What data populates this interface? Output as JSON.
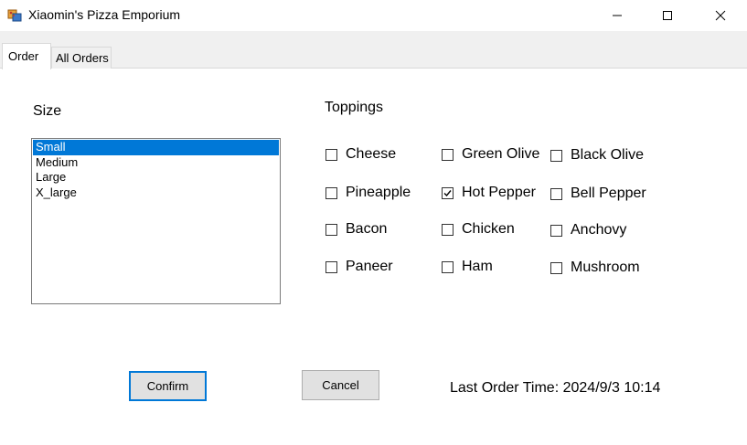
{
  "window": {
    "title": "Xiaomin's Pizza Emporium",
    "icon": "pizza-app-icon",
    "controls": [
      "minimize-icon",
      "maximize-icon",
      "close-icon"
    ]
  },
  "tabs": [
    {
      "label": "Order",
      "selected": true
    },
    {
      "label": "All Orders",
      "selected": false
    }
  ],
  "size": {
    "label": "Size",
    "options": [
      "Small",
      "Medium",
      "Large",
      "X_large"
    ],
    "selected": "Small"
  },
  "toppings": {
    "label": "Toppings",
    "items": [
      {
        "label": "Cheese",
        "checked": false
      },
      {
        "label": "Green Olive",
        "checked": false
      },
      {
        "label": "Black Olive",
        "checked": false
      },
      {
        "label": "Pineapple",
        "checked": false
      },
      {
        "label": "Hot Pepper",
        "checked": true
      },
      {
        "label": "Bell Pepper",
        "checked": false
      },
      {
        "label": "Bacon",
        "checked": false
      },
      {
        "label": "Chicken",
        "checked": false
      },
      {
        "label": "Anchovy",
        "checked": false
      },
      {
        "label": "Paneer",
        "checked": false
      },
      {
        "label": "Ham",
        "checked": false
      },
      {
        "label": "Mushroom",
        "checked": false
      }
    ]
  },
  "buttons": {
    "confirm_label": "Confirm",
    "cancel_label": "Cancel"
  },
  "status": {
    "last_order_text": "Last Order Time: 2024/9/3 10:14"
  },
  "colors": {
    "selection": "#0078d7",
    "focus_border": "#0078d7",
    "button_face": "#e1e1e1"
  }
}
